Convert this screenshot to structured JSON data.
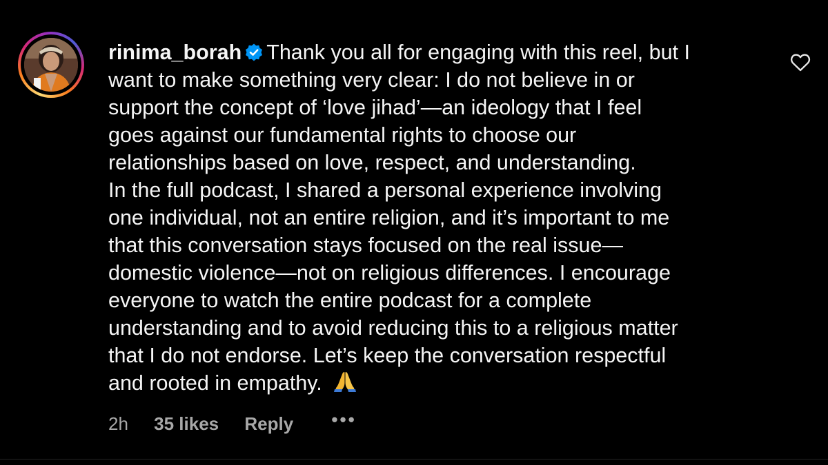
{
  "comment": {
    "username": "rinima_borah",
    "lines": [
      "Thank you all for engaging with this reel, but I",
      "want to make something very clear: I do not believe in or",
      "support the concept of ‘love jihad’—an ideology that I feel",
      "goes against our fundamental rights to choose our",
      "relationships based on love, respect, and understanding.",
      "In the full podcast, I shared a personal experience involving",
      "one individual, not an entire religion, and it’s important to me",
      "that this conversation stays focused on the real issue—",
      "domestic violence—not on religious differences. I encourage",
      "everyone to watch the entire podcast for a complete",
      "understanding and to avoid reducing this to a religious matter",
      "that I do not endorse. Let’s keep the conversation respectful",
      "and rooted in empathy."
    ],
    "meta": {
      "time": "2h",
      "likes": "35 likes",
      "reply": "Reply",
      "more": "•••"
    }
  },
  "icons": {
    "verified": "verified-badge-icon",
    "heart": "heart-outline-icon",
    "emoji": "folded-hands-emoji-icon"
  },
  "colors": {
    "background": "#000000",
    "text": "#f5f5f5",
    "secondary_text": "#a8a8a8",
    "verified_blue": "#0095f6"
  }
}
